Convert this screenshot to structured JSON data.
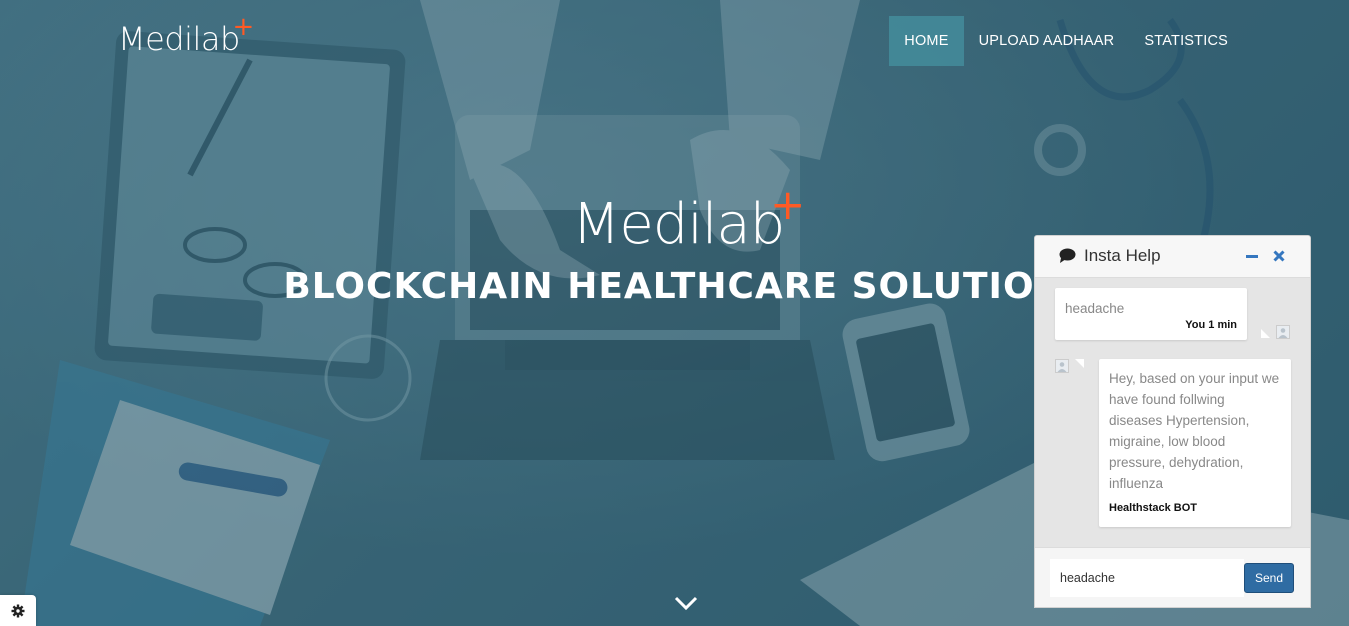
{
  "header": {
    "logo_text": "Medilab",
    "logo_plus": "+",
    "nav": [
      {
        "label": "HOME",
        "active": true
      },
      {
        "label": "UPLOAD AADHAAR",
        "active": false
      },
      {
        "label": "STATISTICS",
        "active": false
      }
    ]
  },
  "hero": {
    "logo_text": "Medilab",
    "logo_plus": "+",
    "title": "BLOCKCHAIN HEALTHCARE SOLUTION",
    "scroll_icon": "chevron-down-icon"
  },
  "chat": {
    "title": "Insta Help",
    "messages": [
      {
        "from": "you",
        "text": "headache",
        "meta": "You 1 min"
      },
      {
        "from": "bot",
        "text": "Hey, based on your input we have found follwing diseases Hypertension, migraine, low blood pressure, dehydration, influenza",
        "meta": "Healthstack BOT"
      }
    ],
    "input_value": "headache",
    "send_label": "Send"
  },
  "colors": {
    "accent_plus": "#ff5a24",
    "nav_active": "#4691a0",
    "send_button": "#2f6ca3",
    "chat_icons": "#3577bf"
  },
  "icons": [
    "comment-icon",
    "minimize-icon",
    "close-icon",
    "user-avatar-icon",
    "gear-icon",
    "chevron-down-icon"
  ]
}
